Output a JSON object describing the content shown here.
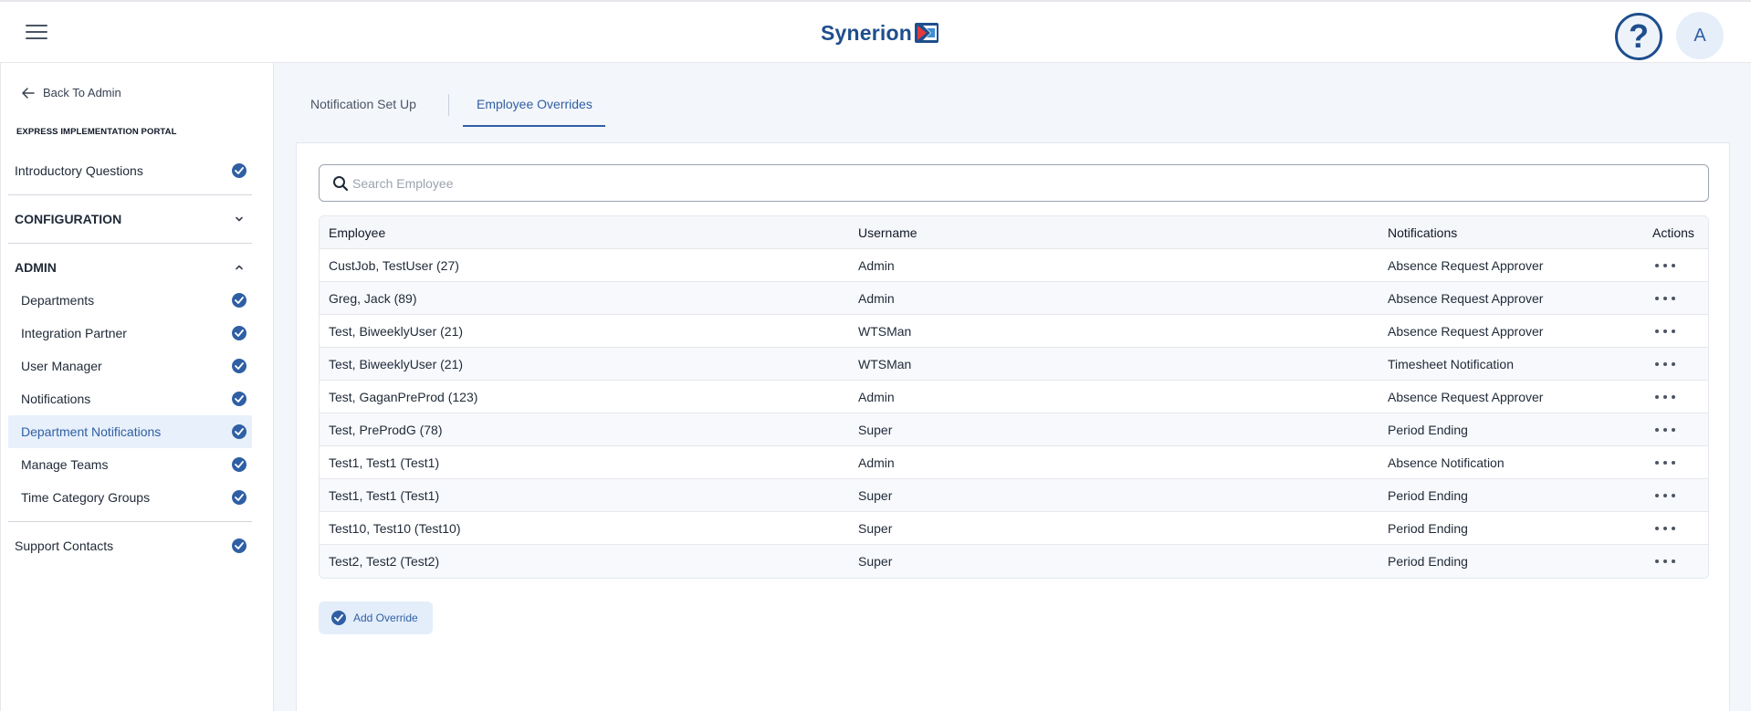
{
  "header": {
    "logo_text": "Synerion",
    "help_glyph": "?",
    "avatar_initial": "A"
  },
  "sidebar": {
    "back_label": "Back To Admin",
    "portal_label": "EXPRESS IMPLEMENTATION PORTAL",
    "intro_label": "Introductory Questions",
    "configuration_label": "CONFIGURATION",
    "admin_label": "ADMIN",
    "admin_items": [
      {
        "label": "Departments"
      },
      {
        "label": "Integration Partner"
      },
      {
        "label": "User Manager"
      },
      {
        "label": "Notifications"
      },
      {
        "label": "Department Notifications"
      },
      {
        "label": "Manage Teams"
      },
      {
        "label": "Time Category Groups"
      }
    ],
    "support_label": "Support Contacts"
  },
  "tabs": [
    {
      "label": "Notification Set Up"
    },
    {
      "label": "Employee Overrides"
    }
  ],
  "search": {
    "placeholder": "Search Employee"
  },
  "table": {
    "columns": [
      "Employee",
      "Username",
      "Notifications",
      "Actions"
    ],
    "rows": [
      {
        "employee": "CustJob, TestUser (27)",
        "username": "Admin",
        "notifications": "Absence Request Approver"
      },
      {
        "employee": "Greg, Jack (89)",
        "username": "Admin",
        "notifications": "Absence Request Approver"
      },
      {
        "employee": "Test, BiweeklyUser (21)",
        "username": "WTSMan",
        "notifications": "Absence Request Approver"
      },
      {
        "employee": "Test, BiweeklyUser (21)",
        "username": "WTSMan",
        "notifications": "Timesheet Notification"
      },
      {
        "employee": "Test, GaganPreProd (123)",
        "username": "Admin",
        "notifications": "Absence Request Approver"
      },
      {
        "employee": "Test, PreProdG (78)",
        "username": "Super",
        "notifications": "Period Ending"
      },
      {
        "employee": "Test1, Test1 (Test1)",
        "username": "Admin",
        "notifications": "Absence Notification"
      },
      {
        "employee": "Test1, Test1 (Test1)",
        "username": "Super",
        "notifications": "Period Ending"
      },
      {
        "employee": "Test10, Test10 (Test10)",
        "username": "Super",
        "notifications": "Period Ending"
      },
      {
        "employee": "Test2, Test2 (Test2)",
        "username": "Super",
        "notifications": "Period Ending"
      }
    ]
  },
  "add_override_label": "Add Override",
  "colors": {
    "accent": "#2f5fa4",
    "brand": "#1e4e8c",
    "active_bg": "#e8f0fb"
  }
}
